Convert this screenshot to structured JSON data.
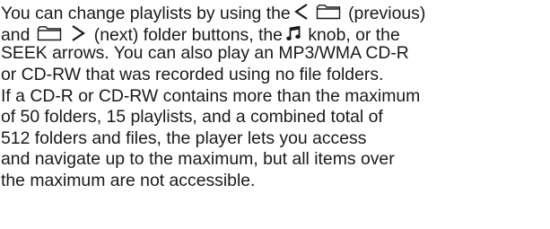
{
  "paragraph": {
    "l1_a": "You can change playlists by using the",
    "l1_b": "(previous)",
    "l2_a": "and",
    "l2_b": "(next) folder buttons, the",
    "l2_c": "knob, or the",
    "l3": "SEEK arrows. You can also play an MP3/WMA CD-R",
    "l4": "or CD-RW that was recorded using no file folders.",
    "l5": "If a CD-R or CD-RW contains more than the maximum",
    "l6": "of 50 folders, 15 playlists, and a combined total of",
    "l7": "512 folders and files, the player lets you access",
    "l8": "and navigate up to the maximum, but all items over",
    "l9": "the maximum are not accessible."
  },
  "icons": {
    "previous": "chevron-left-icon",
    "folder": "folder-icon",
    "next": "chevron-right-icon",
    "knob": "music-note-icon"
  }
}
